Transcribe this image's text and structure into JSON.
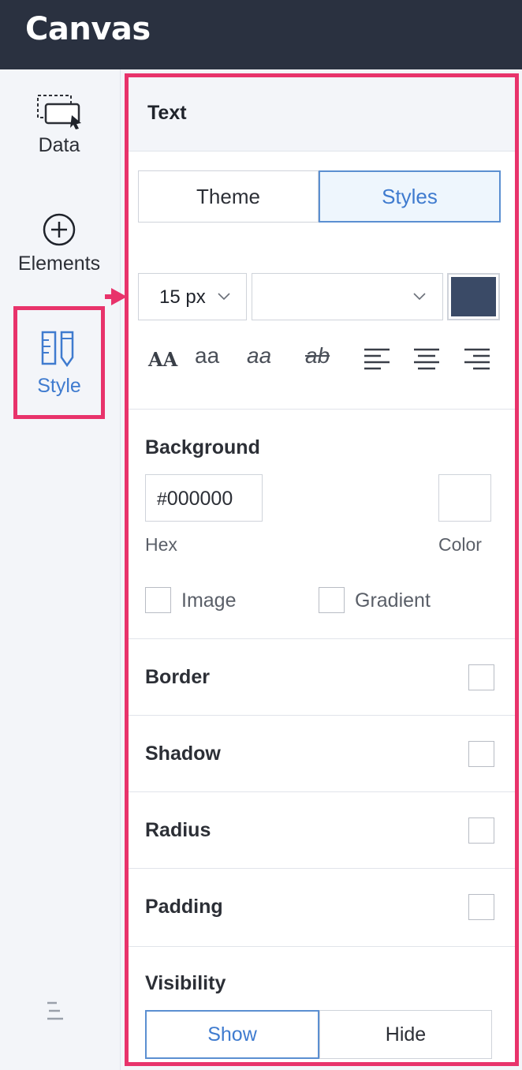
{
  "app": {
    "logo_text": "Canvas"
  },
  "nav": {
    "data_label": "Data",
    "elements_label": "Elements",
    "style_label": "Style"
  },
  "panel": {
    "title": "Text",
    "tabs": [
      {
        "label": "Theme",
        "active": false
      },
      {
        "label": "Styles",
        "active": true
      }
    ],
    "font_size": "15 px",
    "font_family": "",
    "text_color": "#3a4a66",
    "formatting": {
      "caps": "AA",
      "lower": "aa",
      "italic": "aa",
      "strike": "ab"
    },
    "background": {
      "title": "Background",
      "hex_value": "000000",
      "hex_prefix": "#",
      "hex_label": "Hex",
      "color_label": "Color",
      "image_label": "Image",
      "gradient_label": "Gradient"
    },
    "border_title": "Border",
    "shadow_title": "Shadow",
    "radius_title": "Radius",
    "padding_title": "Padding",
    "visibility": {
      "title": "Visibility",
      "show_label": "Show",
      "hide_label": "Hide",
      "selected": "Show"
    }
  },
  "colors": {
    "highlight": "#e8336b",
    "accent": "#3f7bcf",
    "topbar": "#2a3140"
  }
}
